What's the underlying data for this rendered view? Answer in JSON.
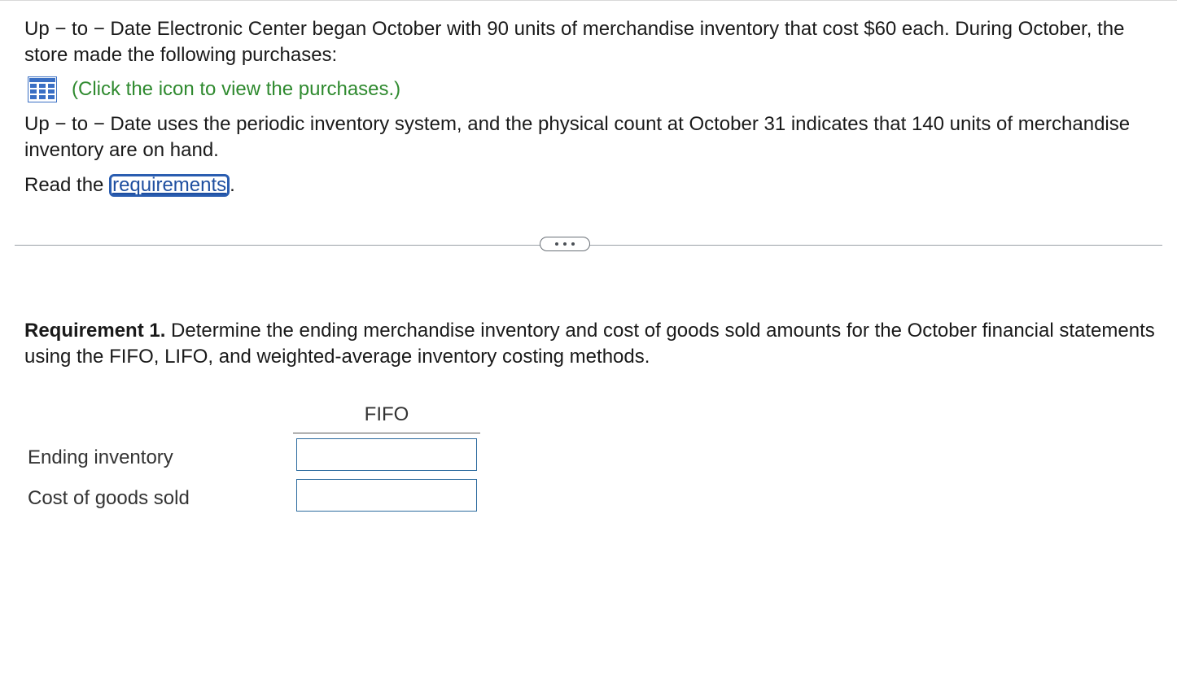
{
  "problem": {
    "intro": "Up − to − Date Electronic Center began October with 90 units of merchandise inventory that cost $60 each. During October, the store made the following purchases:",
    "purchases_link": "(Click the icon to view the purchases.)",
    "system_text": "Up − to − Date uses the periodic inventory system, and the physical count at October 31 indicates that 140 units of merchandise inventory are on hand.",
    "read_prefix": "Read the ",
    "requirements_link": "requirements",
    "read_suffix": "."
  },
  "icons": {
    "purchases": "table-grid-icon",
    "more": "ellipsis-icon"
  },
  "requirement1": {
    "label": "Requirement 1.",
    "text": " Determine the ending merchandise inventory and cost of goods sold amounts for the October financial statements using the FIFO, LIFO, and weighted-average inventory costing methods."
  },
  "table": {
    "column_header": "FIFO",
    "rows": [
      {
        "label": "Ending inventory",
        "value": ""
      },
      {
        "label": "Cost of goods sold",
        "value": ""
      }
    ]
  },
  "colors": {
    "link_green": "#2f8a2f",
    "link_blue": "#1f4fa0",
    "input_border": "#2b6a9e"
  }
}
